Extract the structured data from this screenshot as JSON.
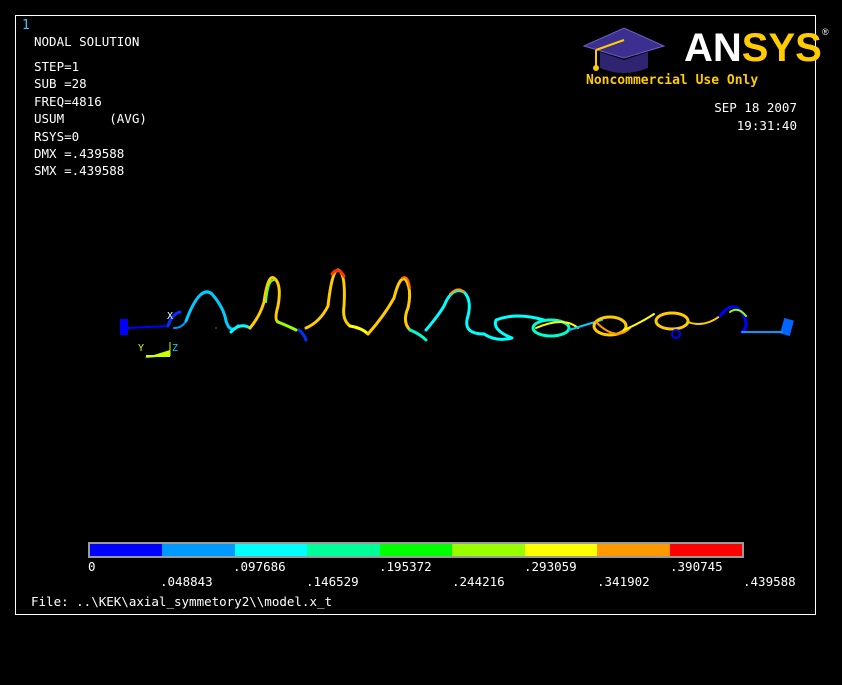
{
  "window": {
    "number": "1"
  },
  "solution": {
    "title": "NODAL SOLUTION",
    "lines": [
      "STEP=1",
      "SUB =28",
      "FREQ=4816",
      "USUM      (AVG)",
      "RSYS=0",
      "DMX =.439588",
      "SMX =.439588"
    ]
  },
  "logo": {
    "text_left": "AN",
    "text_mid": "SYS",
    "registered": "®",
    "license": "Noncommercial Use Only"
  },
  "timestamp": {
    "date": "SEP 18 2007",
    "time": "19:31:40"
  },
  "axis_triad": {
    "y_label": "Y",
    "z_label": "Z",
    "x_label": "X"
  },
  "legend": {
    "colors": [
      "#0000ff",
      "#0099ff",
      "#00ffff",
      "#00ff99",
      "#00ff00",
      "#99ff00",
      "#ffff00",
      "#ff9900",
      "#ff0000"
    ],
    "labels_top": [
      "0",
      ".097686",
      ".195372",
      ".293059",
      ".390745"
    ],
    "labels_bottom": [
      ".048843",
      ".146529",
      ".244216",
      ".341902",
      ".439588"
    ]
  },
  "file": {
    "label": "File: ..\\KEK\\axial_symmetory2\\\\model.x_t"
  }
}
